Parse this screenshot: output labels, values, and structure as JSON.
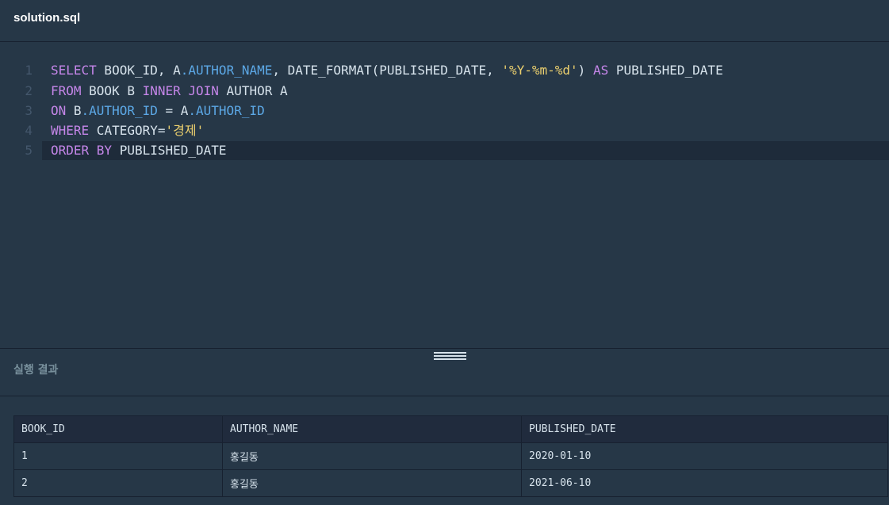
{
  "file_tab": {
    "name": "solution.sql"
  },
  "editor": {
    "active_line": 5,
    "lines": [
      {
        "number": "1",
        "tokens": [
          {
            "t": "SELECT",
            "c": "kw"
          },
          {
            "t": " BOOK_ID, A",
            "c": ""
          },
          {
            "t": ".AUTHOR_NAME",
            "c": "prop"
          },
          {
            "t": ", DATE_FORMAT(PUBLISHED_DATE, ",
            "c": ""
          },
          {
            "t": "'%Y-%m-%d'",
            "c": "str"
          },
          {
            "t": ") ",
            "c": ""
          },
          {
            "t": "AS",
            "c": "kw"
          },
          {
            "t": " PUBLISHED_DATE",
            "c": ""
          }
        ]
      },
      {
        "number": "2",
        "tokens": [
          {
            "t": "FROM",
            "c": "kw"
          },
          {
            "t": " BOOK B ",
            "c": ""
          },
          {
            "t": "INNER JOIN",
            "c": "kw"
          },
          {
            "t": " AUTHOR A",
            "c": ""
          }
        ]
      },
      {
        "number": "3",
        "tokens": [
          {
            "t": "ON",
            "c": "kw"
          },
          {
            "t": " B",
            "c": ""
          },
          {
            "t": ".AUTHOR_ID",
            "c": "prop"
          },
          {
            "t": " = A",
            "c": ""
          },
          {
            "t": ".AUTHOR_ID",
            "c": "prop"
          }
        ]
      },
      {
        "number": "4",
        "tokens": [
          {
            "t": "WHERE",
            "c": "kw"
          },
          {
            "t": " CATEGORY=",
            "c": ""
          },
          {
            "t": "'경제'",
            "c": "str"
          }
        ]
      },
      {
        "number": "5",
        "tokens": [
          {
            "t": "ORDER BY",
            "c": "kw"
          },
          {
            "t": " PUBLISHED_DATE",
            "c": ""
          }
        ]
      }
    ]
  },
  "results": {
    "title": "실행 결과",
    "columns": [
      "BOOK_ID",
      "AUTHOR_NAME",
      "PUBLISHED_DATE"
    ],
    "rows": [
      [
        "1",
        "홍길동",
        "2020-01-10"
      ],
      [
        "2",
        "홍길동",
        "2021-06-10"
      ]
    ]
  },
  "colors": {
    "background": "#263747",
    "keyword": "#c586e9",
    "property": "#5ca8e6",
    "string": "#ecd06e",
    "text": "#d6e2eb",
    "line_number": "#44576c"
  }
}
